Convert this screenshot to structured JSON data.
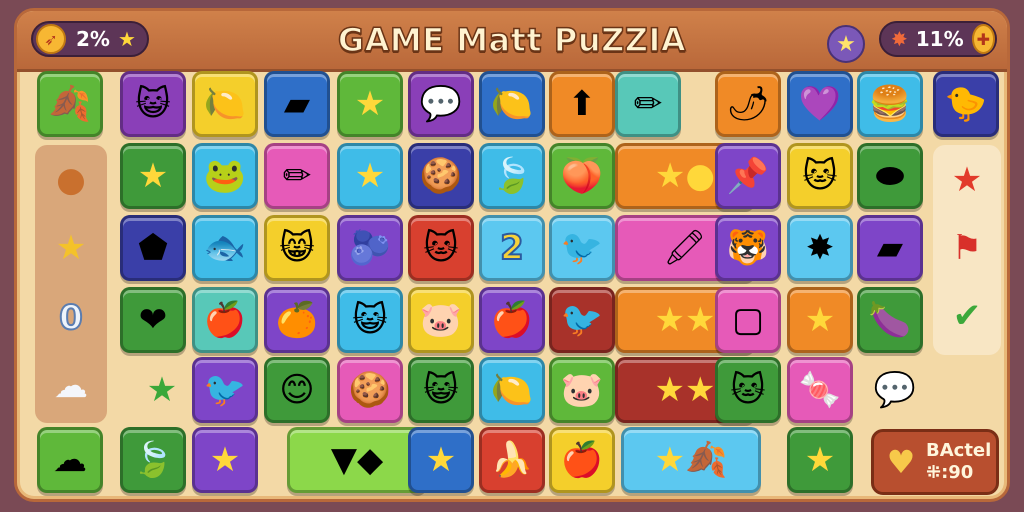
{
  "header": {
    "title": "GAME Matt PuZZIA",
    "left_stat": "2%",
    "right_stat": "11%"
  },
  "score_panel": {
    "label": "BActel",
    "value": "⁜:90"
  },
  "left_panel": {
    "icons": [
      "cookie-icon",
      "star-icon",
      "zero-digit",
      "cloud-icon"
    ],
    "digit": "0"
  },
  "right_panel": {
    "icons": [
      "star-icon",
      "flag-icon",
      "checkmark-icon"
    ]
  },
  "tiles": [
    {
      "name": "leaf-tile",
      "color": "green",
      "glyph": "🍂"
    },
    {
      "name": "cat-face-tile",
      "color": "purple",
      "glyph": "😺"
    },
    {
      "name": "lemon-tile",
      "color": "yellow",
      "glyph": "🍋"
    },
    {
      "name": "eraser-tile",
      "color": "blue",
      "glyph": "▰"
    },
    {
      "name": "star-tile",
      "color": "green",
      "glyph": "★"
    },
    {
      "name": "speech-bubble-tile",
      "color": "purple",
      "glyph": "💬"
    },
    {
      "name": "lemon-tile",
      "color": "blue",
      "glyph": "🍋"
    },
    {
      "name": "arrow-up-tile",
      "color": "orange",
      "glyph": "⬆"
    },
    {
      "name": "pencil-leaf-tile",
      "color": "teal",
      "glyph": "✏"
    },
    {
      "name": "pepper-tile",
      "color": "orange",
      "glyph": "🌶"
    },
    {
      "name": "heart-tile",
      "color": "blue",
      "glyph": "💜"
    },
    {
      "name": "macaron-tile",
      "color": "cyan",
      "glyph": "🍔"
    },
    {
      "name": "duck-tile",
      "color": "navy",
      "glyph": "🐤"
    },
    {
      "name": "star-tile",
      "color": "dkgreen",
      "glyph": "★"
    },
    {
      "name": "frog-tile",
      "color": "cyan",
      "glyph": "🐸"
    },
    {
      "name": "pencil-tile",
      "color": "pink",
      "glyph": "✏"
    },
    {
      "name": "star-tile",
      "color": "cyan",
      "glyph": "★"
    },
    {
      "name": "macaron-tile",
      "color": "navy",
      "glyph": "🍪"
    },
    {
      "name": "leaf-tile",
      "color": "cyan",
      "glyph": "🍃"
    },
    {
      "name": "peach-tile",
      "color": "green",
      "glyph": "🍑"
    },
    {
      "name": "star-bomb-tile",
      "color": "orange",
      "glyph": "★●",
      "wide": true
    },
    {
      "name": "pin-tile",
      "color": "violet",
      "glyph": "📌"
    },
    {
      "name": "cat-face-tile",
      "color": "yellow",
      "glyph": "🐱"
    },
    {
      "name": "pink-candy-tile",
      "color": "dkgreen",
      "glyph": "⬬"
    },
    {
      "name": "gem-tile",
      "color": "navy",
      "glyph": "⬟"
    },
    {
      "name": "fish-tile",
      "color": "cyan",
      "glyph": "🐟"
    },
    {
      "name": "cat-face-tile",
      "color": "yellow",
      "glyph": "😸"
    },
    {
      "name": "plum-tile",
      "color": "violet",
      "glyph": "🫐"
    },
    {
      "name": "cat-face-tile",
      "color": "red",
      "glyph": "🐱"
    },
    {
      "name": "number-two-tile",
      "color": "sky",
      "glyph": "2"
    },
    {
      "name": "blue-bird-tile",
      "color": "sky",
      "glyph": "🐦"
    },
    {
      "name": "crayon-tile",
      "color": "pink",
      "glyph": "🖍",
      "wide": true
    },
    {
      "name": "cat-face-tile",
      "color": "violet",
      "glyph": "🐯"
    },
    {
      "name": "star-tile",
      "color": "sky",
      "glyph": "✸"
    },
    {
      "name": "eraser-tile",
      "color": "violet",
      "glyph": "▰"
    },
    {
      "name": "heart-tile",
      "color": "dkgreen",
      "glyph": "❤"
    },
    {
      "name": "apple-tile",
      "color": "teal",
      "glyph": "🍎"
    },
    {
      "name": "orange-tile",
      "color": "violet",
      "glyph": "🍊"
    },
    {
      "name": "cat-face-tile",
      "color": "cyan",
      "glyph": "😺"
    },
    {
      "name": "pig-face-tile",
      "color": "yellow",
      "glyph": "🐷"
    },
    {
      "name": "apple-tile",
      "color": "violet",
      "glyph": "🍎"
    },
    {
      "name": "blue-bird-tile",
      "color": "maroon",
      "glyph": "🐦"
    },
    {
      "name": "double-star-tile",
      "color": "orange",
      "glyph": "★★",
      "wide": true
    },
    {
      "name": "square-tile",
      "color": "pink",
      "glyph": "▢"
    },
    {
      "name": "star-tile",
      "color": "orange",
      "glyph": "★"
    },
    {
      "name": "plum-tile",
      "color": "dkgreen",
      "glyph": "🍆"
    },
    {
      "name": "star-tile",
      "color": "none",
      "glyph": "★"
    },
    {
      "name": "bird-tile",
      "color": "violet",
      "glyph": "🐦"
    },
    {
      "name": "smiley-tile",
      "color": "dkgreen",
      "glyph": "😊"
    },
    {
      "name": "macaron-tile",
      "color": "pink",
      "glyph": "🍪"
    },
    {
      "name": "cat-face-tile",
      "color": "dkgreen",
      "glyph": "😺"
    },
    {
      "name": "lemon-tile",
      "color": "cyan",
      "glyph": "🍋"
    },
    {
      "name": "pig-face-tile",
      "color": "green",
      "glyph": "🐷"
    },
    {
      "name": "double-star-tile",
      "color": "maroon",
      "glyph": "★★",
      "wide": true
    },
    {
      "name": "cat-face-tile",
      "color": "dkgreen",
      "glyph": "🐱"
    },
    {
      "name": "candy-tile",
      "color": "pink",
      "glyph": "🍬"
    },
    {
      "name": "bubble-tile",
      "color": "none",
      "glyph": "💬"
    },
    {
      "name": "cloud-tile",
      "color": "green",
      "glyph": "☁"
    },
    {
      "name": "leaf-tile",
      "color": "dkgreen",
      "glyph": "🍃"
    },
    {
      "name": "star-tile",
      "color": "violet",
      "glyph": "★"
    },
    {
      "name": "arrow-candy-tile",
      "color": "lime",
      "glyph": "▼◆",
      "wide": true
    },
    {
      "name": "star-tile",
      "color": "blue",
      "glyph": "★"
    },
    {
      "name": "banana-tile",
      "color": "red",
      "glyph": "🍌"
    },
    {
      "name": "apple-tile",
      "color": "yellow",
      "glyph": "🍎"
    },
    {
      "name": "star-leaf-tile",
      "color": "sky",
      "glyph": "★🍂",
      "wide": true
    },
    {
      "name": "star-tile",
      "color": "dkgreen",
      "glyph": "★"
    }
  ],
  "colors": {
    "frame_bg": "#f3d9a6",
    "topbar": "#c07040",
    "title_fill": "#fff3d0",
    "star": "#ffd83a"
  }
}
